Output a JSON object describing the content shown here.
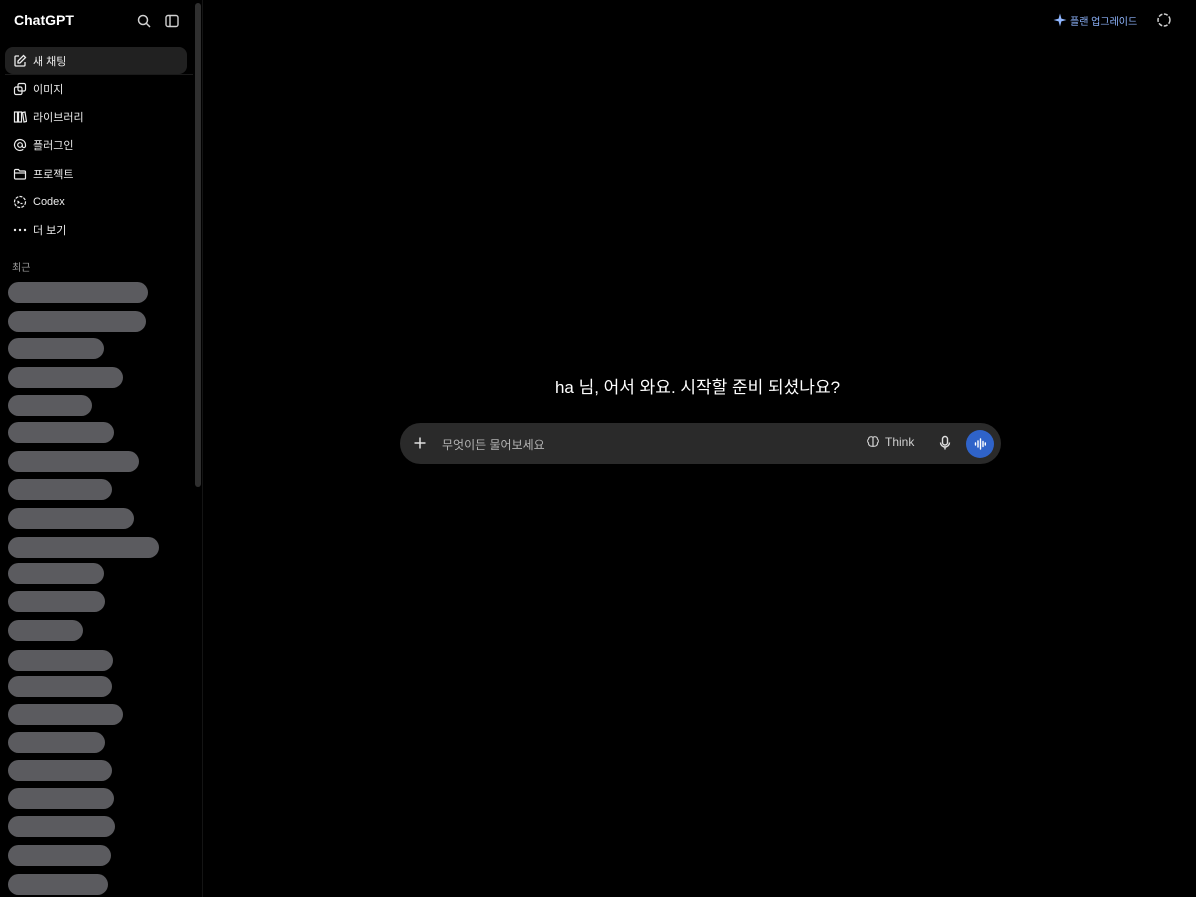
{
  "app": {
    "brand": "ChatGPT"
  },
  "sidebar": {
    "items": [
      {
        "label": "새 채팅",
        "icon": "edit-icon"
      },
      {
        "label": "이미지",
        "icon": "images-icon"
      },
      {
        "label": "라이브러리",
        "icon": "library-icon"
      },
      {
        "label": "플러그인",
        "icon": "at-icon"
      },
      {
        "label": "프로젝트",
        "icon": "folder-icon"
      },
      {
        "label": "Codex",
        "icon": "codex-icon"
      },
      {
        "label": "더 보기",
        "icon": "more-icon"
      }
    ],
    "recent_title": "최근"
  },
  "header": {
    "upgrade_label": "플랜 업그레이드"
  },
  "main": {
    "welcome": "ha 님, 어서 와요. 시작할 준비 되셨나요?",
    "composer": {
      "placeholder": "무엇이든 물어보세요",
      "think_label": "Think"
    }
  },
  "colors": {
    "accent": "#2f63c9",
    "upgrade": "#8fb6ff"
  }
}
